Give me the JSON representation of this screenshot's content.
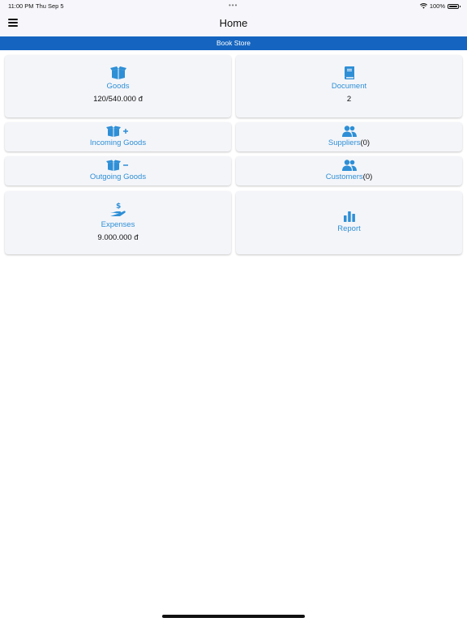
{
  "status_bar": {
    "time": "11:00 PM",
    "date": "Thu Sep 5",
    "battery": "100%"
  },
  "header": {
    "title": "Home"
  },
  "store": {
    "name": "Book Store"
  },
  "cards": {
    "goods": {
      "label": "Goods",
      "value": "120/540.000 đ"
    },
    "document": {
      "label": "Document",
      "value": "2"
    },
    "incoming": {
      "label": "Incoming Goods"
    },
    "suppliers": {
      "label": "Suppliers",
      "count": "(0)"
    },
    "outgoing": {
      "label": "Outgoing Goods"
    },
    "customers": {
      "label": "Customers",
      "count": "(0)"
    },
    "expenses": {
      "label": "Expenses",
      "value": "9.000.000 đ"
    },
    "report": {
      "label": "Report"
    }
  },
  "colors": {
    "accent": "#2e8fd6",
    "banner": "#1565c0",
    "card": "#f4f5f9"
  },
  "icons": [
    "menu-icon",
    "box-icon",
    "book-icon",
    "box-plus-icon",
    "users-icon",
    "box-minus-icon",
    "hand-dollar-icon",
    "bar-chart-icon",
    "wifi-icon",
    "battery-icon"
  ]
}
